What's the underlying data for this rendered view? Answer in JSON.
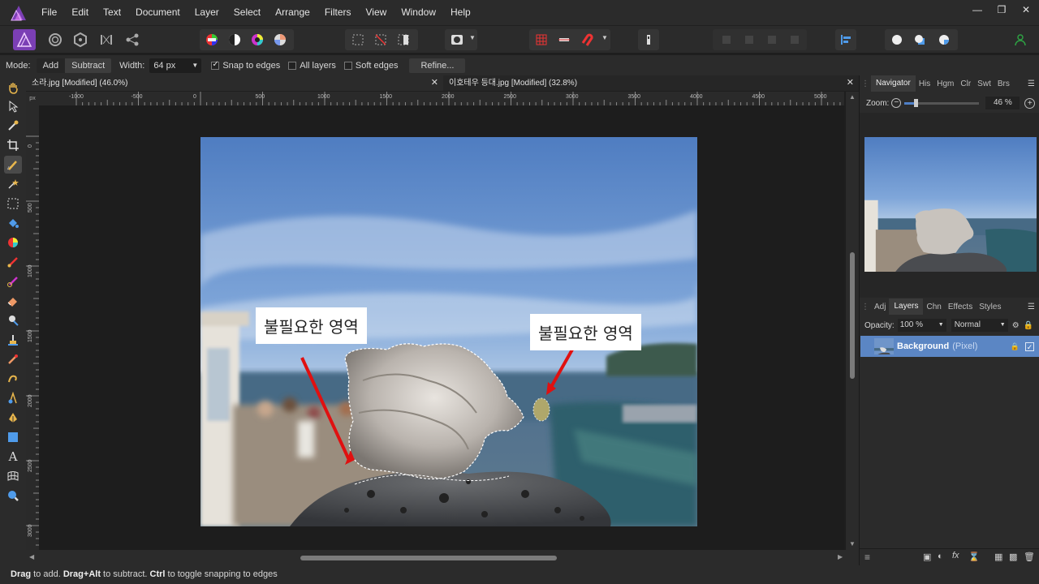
{
  "menubar": {
    "items": [
      "File",
      "Edit",
      "Text",
      "Document",
      "Layer",
      "Select",
      "Arrange",
      "Filters",
      "View",
      "Window",
      "Help"
    ]
  },
  "context": {
    "mode_label": "Mode:",
    "mode_add": "Add",
    "mode_subtract": "Subtract",
    "width_label": "Width:",
    "width_value": "64 px",
    "snap_label": "Snap to edges",
    "snap_checked": true,
    "all_layers_label": "All layers",
    "soft_edges_label": "Soft edges",
    "refine_label": "Refine..."
  },
  "tabs": [
    {
      "title": "소라.jpg [Modified] (46.0%)"
    },
    {
      "title": "이호테우 등대.jpg [Modified] (32.8%)"
    }
  ],
  "ruler": {
    "unit": "px",
    "top_ticks": [
      "-1000",
      "-500",
      "0",
      "500",
      "1000",
      "1500",
      "2000",
      "2500",
      "3000",
      "3500",
      "4000",
      "4500",
      "5000"
    ],
    "left_ticks": [
      "0",
      "500",
      "1000",
      "1500",
      "2000",
      "2500",
      "3000"
    ]
  },
  "annotations": {
    "left": "불필요한 영역",
    "right": "불필요한 영역"
  },
  "navigator": {
    "tabs": [
      "Navigator",
      "His",
      "Hgm",
      "Clr",
      "Swt",
      "Brs"
    ],
    "zoom_label": "Zoom:",
    "zoom_value": "46 %"
  },
  "layers_panel": {
    "tabs": [
      "Adj",
      "Layers",
      "Chn",
      "Effects",
      "Styles"
    ],
    "opacity_label": "Opacity:",
    "opacity_value": "100 %",
    "blend_mode": "Normal",
    "layers": [
      {
        "name": "Background",
        "type": "(Pixel)",
        "visible": true
      }
    ]
  },
  "status": {
    "drag": "Drag",
    "to_add": " to add. ",
    "drag_alt": "Drag+Alt",
    "to_subtract": " to subtract. ",
    "ctrl": "Ctrl",
    "to_toggle": " to toggle snapping to edges"
  },
  "colors": {
    "accent": "#4f7fc7",
    "selected_layer": "#5b86c4",
    "annotation_arrow": "#e01010"
  }
}
